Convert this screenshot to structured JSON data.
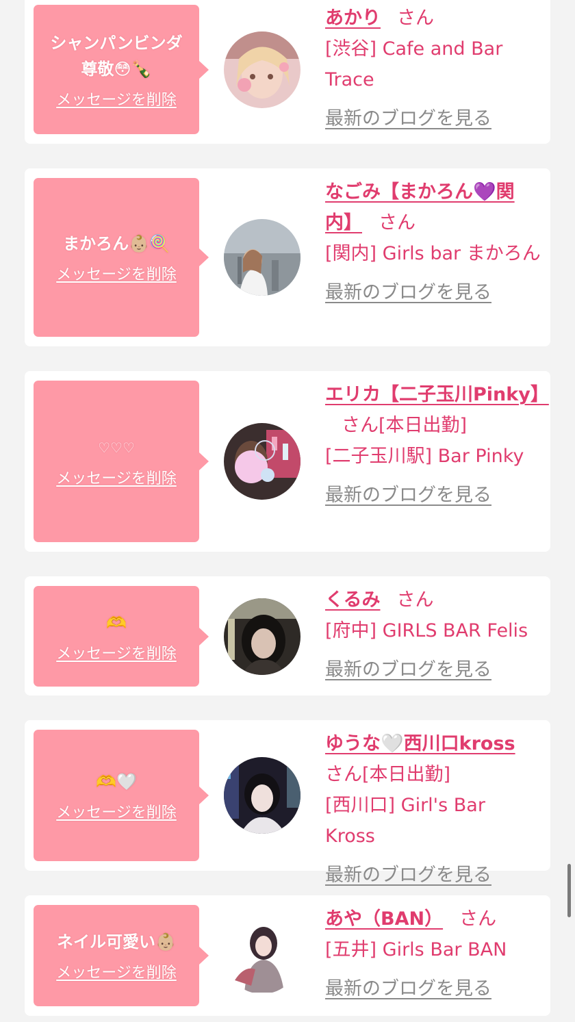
{
  "colors": {
    "background": "#f3f3f3",
    "card": "#ffffff",
    "bubble": "#fe99a6",
    "accent_pink": "#e03c6e",
    "link_gray": "#8a8a8a"
  },
  "entries": [
    {
      "message": "シャンパンビンダ\n尊敬😳🍾",
      "delete_label": "メッセージを削除",
      "name": "あかり",
      "honorific": "さん",
      "status": "",
      "shop": "[渋谷] Cafe and Bar Trace",
      "blog_label": "最新のブログを見る",
      "avatar_icon": "avatar-photo-icon"
    },
    {
      "message": "まかろん👶🏼🍭",
      "delete_label": "メッセージを削除",
      "name": "なごみ【まかろん💜関内】",
      "honorific": "さん",
      "status": "",
      "shop": "[関内] Girls bar まかろん",
      "blog_label": "最新のブログを見る",
      "avatar_icon": "avatar-photo-icon"
    },
    {
      "message": "♡♡♡",
      "delete_label": "メッセージを削除",
      "name": "エリカ【二子玉川Pinky】",
      "honorific": "さん",
      "status": "[本日出勤]",
      "shop": "[二子玉川駅] Bar Pinky",
      "blog_label": "最新のブログを見る",
      "avatar_icon": "avatar-photo-icon"
    },
    {
      "message": "🫶",
      "delete_label": "メッセージを削除",
      "name": "くるみ",
      "honorific": "さん",
      "status": "",
      "shop": "[府中] GIRLS BAR Felis",
      "blog_label": "最新のブログを見る",
      "avatar_icon": "avatar-photo-icon"
    },
    {
      "message": "🫶🤍",
      "delete_label": "メッセージを削除",
      "name": "ゆうな🤍西川口kross",
      "honorific": "さん",
      "status": "[本日出勤]",
      "shop": "[西川口] Girl's Bar Kross",
      "blog_label": "最新のブログを見る",
      "avatar_icon": "avatar-photo-icon"
    },
    {
      "message": "ネイル可愛い👶🏼",
      "delete_label": "メッセージを削除",
      "name": "あや（BAN）",
      "honorific": "さん",
      "status": "",
      "shop": "[五井] Girls Bar BAN",
      "blog_label": "最新のブログを見る",
      "avatar_icon": "avatar-photo-icon"
    }
  ]
}
